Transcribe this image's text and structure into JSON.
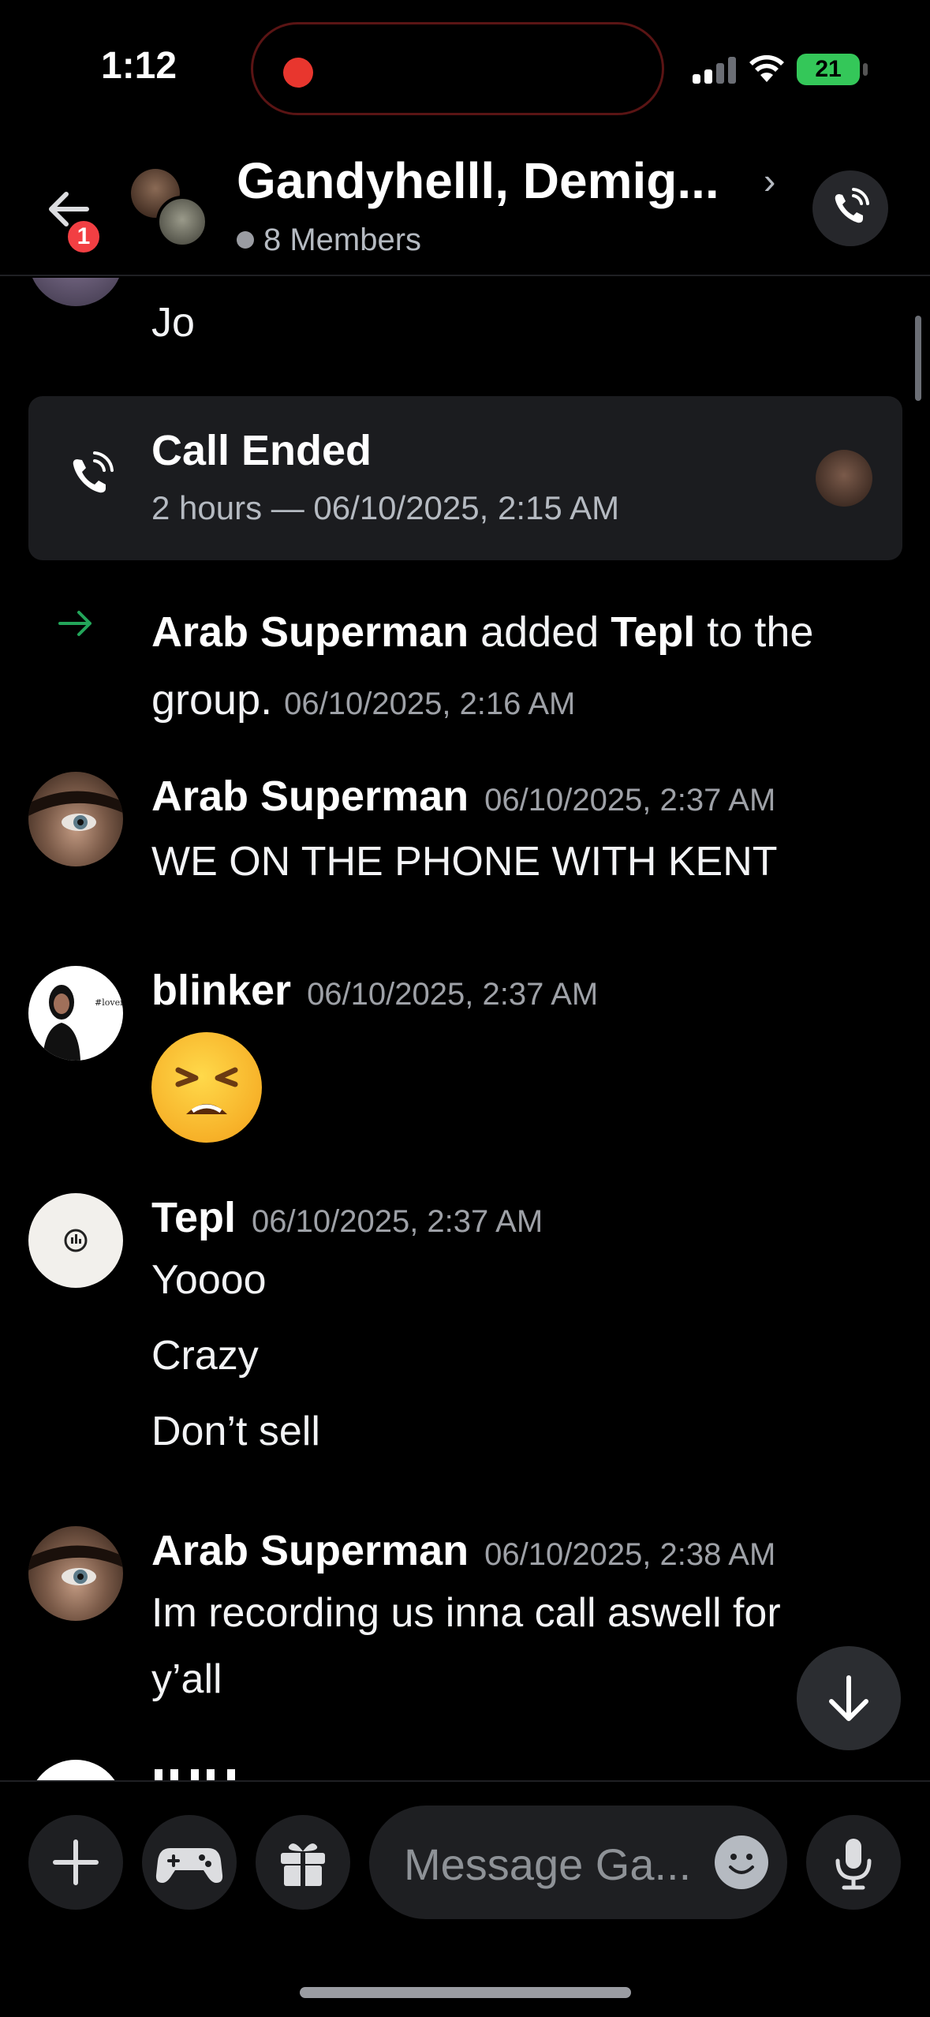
{
  "status_bar": {
    "time": "1:12",
    "battery": "21"
  },
  "header": {
    "back_badge": "1",
    "title": "Gandyhelll, Demig...",
    "members": "8 Members"
  },
  "messages": {
    "partial_text": "Jo",
    "call": {
      "title": "Call Ended",
      "subtitle": "2 hours — 06/10/2025, 2:15 AM"
    },
    "system": {
      "actor": "Arab Superman",
      "action": " added ",
      "target": "Tepl",
      "tail": " to the group.",
      "timestamp": "06/10/2025, 2:16 AM"
    },
    "items": [
      {
        "author": "Arab Superman",
        "timestamp": "06/10/2025, 2:37 AM",
        "lines": [
          "WE ON THE PHONE WITH KENT"
        ]
      },
      {
        "author": "blinker",
        "timestamp": "06/10/2025, 2:37 AM",
        "emoji": "tired-face"
      },
      {
        "author": "Tepl",
        "timestamp": "06/10/2025, 2:37 AM",
        "lines": [
          "Yoooo",
          "Crazy",
          "Don’t sell"
        ]
      },
      {
        "author": "Arab Superman",
        "timestamp": "06/10/2025, 2:38 AM",
        "lines": [
          "Im recording us inna call aswell for",
          "y’all"
        ]
      }
    ]
  },
  "composer": {
    "placeholder": "Message Ga..."
  },
  "colors": {
    "background": "#000000",
    "surface": "#1e1f22",
    "badge": "#f23f43",
    "system_arrow": "#23a55a",
    "recording": "#e8362e",
    "battery": "#34c759"
  }
}
